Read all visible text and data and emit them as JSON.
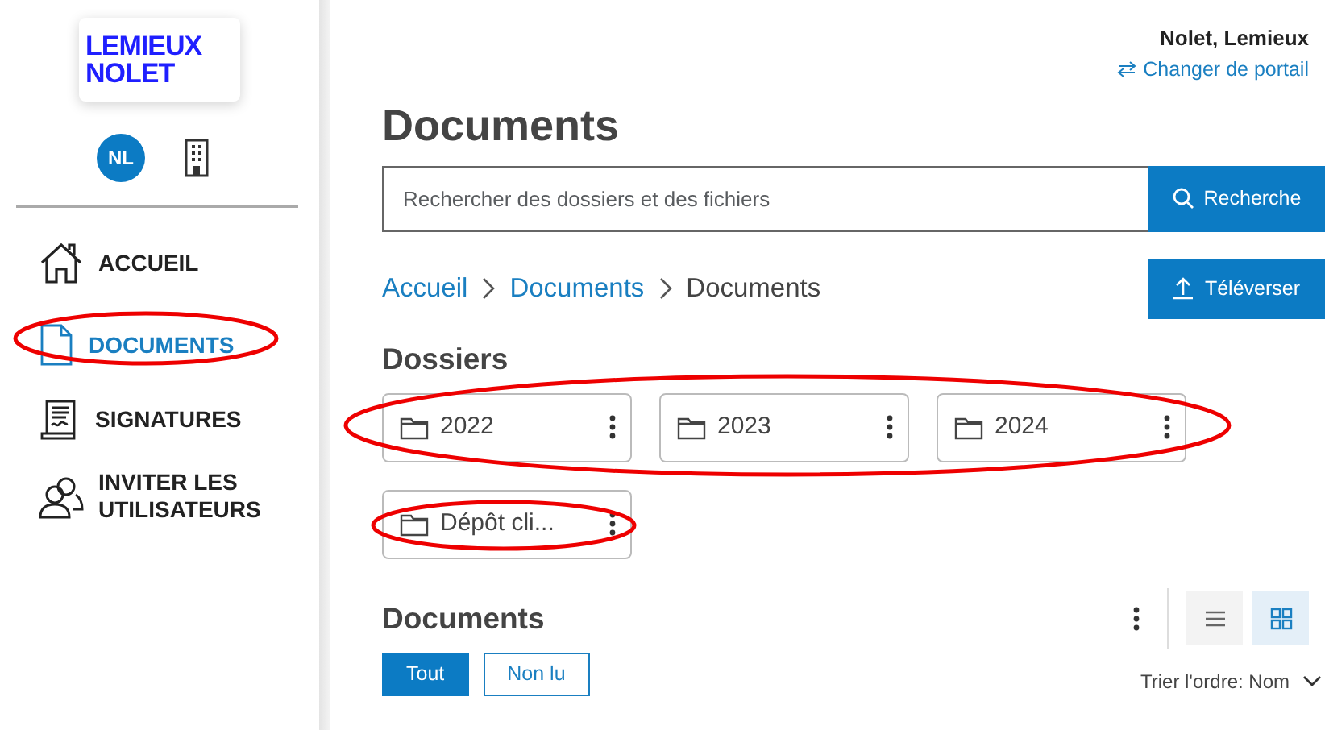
{
  "logo": {
    "lines": [
      "LEMIEUX",
      "NOLET"
    ]
  },
  "avatar": {
    "initials": "NL"
  },
  "nav": [
    {
      "label": "ACCUEIL",
      "selected": false,
      "circled": false
    },
    {
      "label": "DOCUMENTS",
      "selected": true,
      "circled": true
    },
    {
      "label": "SIGNATURES",
      "selected": false,
      "circled": false
    },
    {
      "label": "INVITER LES UTILISATEURS",
      "selected": false,
      "circled": false
    }
  ],
  "user": {
    "name": "Nolet, Lemieux",
    "switch_link": "Changer de portail"
  },
  "page_title": "Documents",
  "search": {
    "placeholder": "Rechercher des dossiers et des fichiers",
    "button": "Recherche"
  },
  "breadcrumb": [
    {
      "label": "Accueil",
      "current": false
    },
    {
      "label": "Documents",
      "current": false
    },
    {
      "label": "Documents",
      "current": true
    }
  ],
  "upload_button": "Téléverser",
  "folders_section": {
    "title": "Dossiers",
    "rows": [
      {
        "circled": true,
        "folders": [
          "2022",
          "2023",
          "2024"
        ]
      },
      {
        "circled": true,
        "folders": [
          "Dépôt cli..."
        ]
      }
    ]
  },
  "documents_section": {
    "title": "Documents",
    "filters": [
      {
        "label": "Tout",
        "selected": true
      },
      {
        "label": "Non lu",
        "selected": false
      }
    ],
    "view_modes": [
      {
        "kind": "list",
        "selected": false
      },
      {
        "kind": "grid",
        "selected": true
      }
    ],
    "sort": "Trier l'ordre: Nom"
  }
}
